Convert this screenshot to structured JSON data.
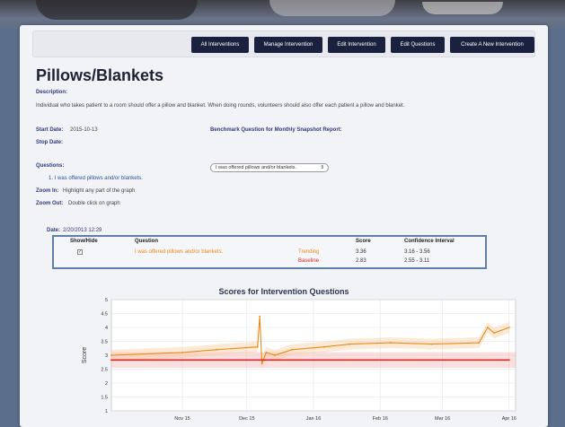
{
  "toolbar": {
    "buttons": [
      "All Interventions",
      "Manage Intervention",
      "Edit Intervention",
      "Edit Questions",
      "Create A New Intervention"
    ]
  },
  "intervention": {
    "title": "Pillows/Blankets",
    "description_label": "Description:",
    "description": "Individual who takes patient to a room should offer a pillow and blanket. When doing rounds, volunteers should also offer each patient a pillow and blanket.",
    "start_date_label": "Start Date:",
    "start_date": "2015-10-13",
    "stop_date_label": "Stop Date:",
    "stop_date": "",
    "benchmark_label": "Benchmark Question for Monthly Snapshot Report:",
    "benchmark_selected": "I was offered pillows and/or blankets.",
    "questions_label": "Questions:",
    "questions": [
      "1. I was offered pillows and/or blankets."
    ],
    "zoom_in_label": "Zoom In:",
    "zoom_in_text": "Highlight any part of the graph",
    "zoom_out_label": "Zoom Out:",
    "zoom_out_text": "Double click on graph"
  },
  "stats": {
    "date_label": "Date:",
    "date": "2/20/2013 12:29",
    "headers": {
      "show_hide": "Show/Hide",
      "question": "Question",
      "score": "Score",
      "ci": "Confidence Interval"
    },
    "question": "I was offered pillows and/or blankets.",
    "trending_label": "Trending",
    "baseline_label": "Baseline",
    "trending_score": "3.36",
    "baseline_score": "2.83",
    "trending_ci": "3.16 - 3.56",
    "baseline_ci": "2.55 - 3.11",
    "checkbox_mark": "✓"
  },
  "colors": {
    "button_bg": "#19213f",
    "trending": "#e8891c",
    "baseline": "#d62828",
    "link": "#2f4f9f"
  },
  "chart_data": {
    "type": "line",
    "title": "Scores for Intervention Questions",
    "ylabel": "Score",
    "xlabel": "",
    "ylim": [
      1,
      5
    ],
    "yticks": [
      "1",
      "1.5",
      "2",
      "2.5",
      "3",
      "3.5",
      "4",
      "4.5",
      "5"
    ],
    "xticks": [
      "Nov 15",
      "Dec 15",
      "Jan 16",
      "Feb 16",
      "Mar 16",
      "Apr 16"
    ],
    "grid": true,
    "series": [
      {
        "name": "Trending",
        "color": "#e8891c",
        "x": [
          "2015-10-13",
          "2015-11-15",
          "2015-12-01",
          "2015-12-20",
          "2015-12-21",
          "2015-12-22",
          "2015-12-24",
          "2015-12-28",
          "2016-01-05",
          "2016-01-20",
          "2016-02-01",
          "2016-02-20",
          "2016-03-10",
          "2016-04-01",
          "2016-04-05",
          "2016-04-08",
          "2016-04-15"
        ],
        "values": [
          3.0,
          3.1,
          3.2,
          3.3,
          4.4,
          2.7,
          3.1,
          3.0,
          3.2,
          3.3,
          3.4,
          3.45,
          3.4,
          3.45,
          4.0,
          3.8,
          4.0
        ]
      },
      {
        "name": "Baseline",
        "color": "#d62828",
        "x": [
          "2015-10-13",
          "2016-04-15"
        ],
        "values": [
          2.83,
          2.83
        ]
      }
    ],
    "baseline_band": [
      2.55,
      3.11
    ]
  }
}
